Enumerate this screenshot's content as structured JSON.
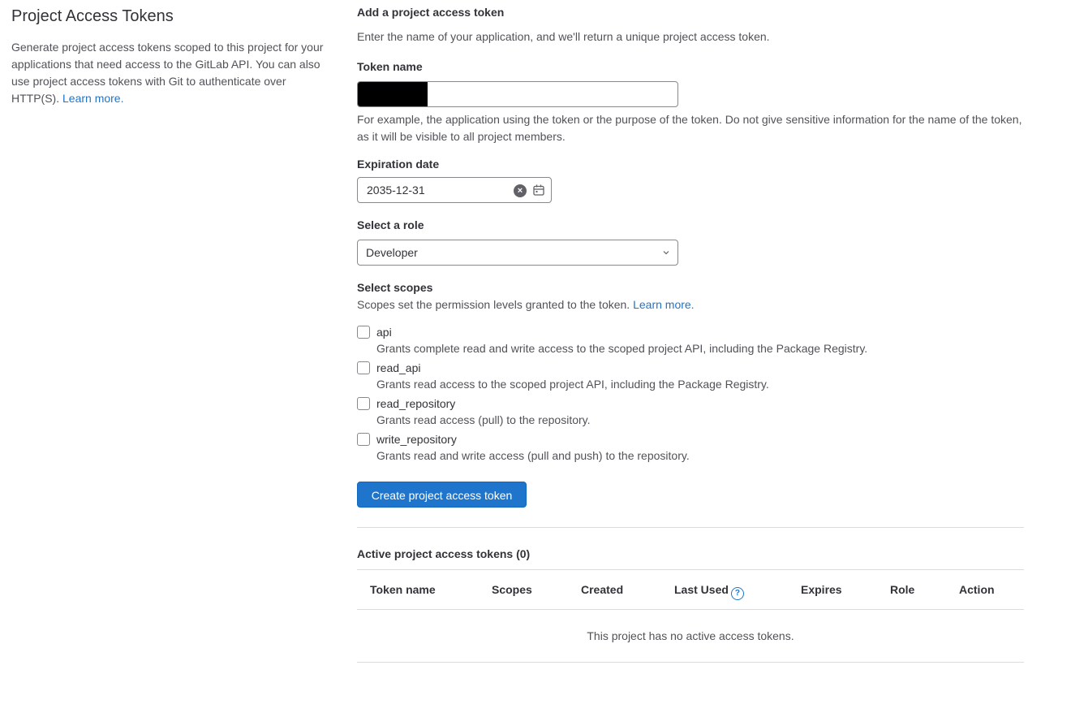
{
  "sidebar": {
    "title": "Project Access Tokens",
    "description": "Generate project access tokens scoped to this project for your applications that need access to the GitLab API. You can also use project access tokens with Git to authenticate over HTTP(S).",
    "learn_more": "Learn more."
  },
  "form": {
    "heading": "Add a project access token",
    "intro": "Enter the name of your application, and we'll return a unique project access token.",
    "token_name_label": "Token name",
    "token_name_help": "For example, the application using the token or the purpose of the token. Do not give sensitive information for the name of the token, as it will be visible to all project members.",
    "expiration_label": "Expiration date",
    "expiration_value": "2035-12-31",
    "role_label": "Select a role",
    "role_value": "Developer",
    "scopes_label": "Select scopes",
    "scopes_help": "Scopes set the permission levels granted to the token.",
    "scopes_learn_more": "Learn more.",
    "scopes": [
      {
        "name": "api",
        "description": "Grants complete read and write access to the scoped project API, including the Package Registry."
      },
      {
        "name": "read_api",
        "description": "Grants read access to the scoped project API, including the Package Registry."
      },
      {
        "name": "read_repository",
        "description": "Grants read access (pull) to the repository."
      },
      {
        "name": "write_repository",
        "description": "Grants read and write access (pull and push) to the repository."
      }
    ],
    "submit_label": "Create project access token"
  },
  "active_tokens": {
    "heading": "Active project access tokens (0)",
    "columns": [
      "Token name",
      "Scopes",
      "Created",
      "Last Used",
      "Expires",
      "Role",
      "Action"
    ],
    "empty_message": "This project has no active access tokens."
  },
  "colors": {
    "accent": "#1f75cb",
    "text": "#333238",
    "muted": "#535158",
    "border": "#89888d"
  }
}
